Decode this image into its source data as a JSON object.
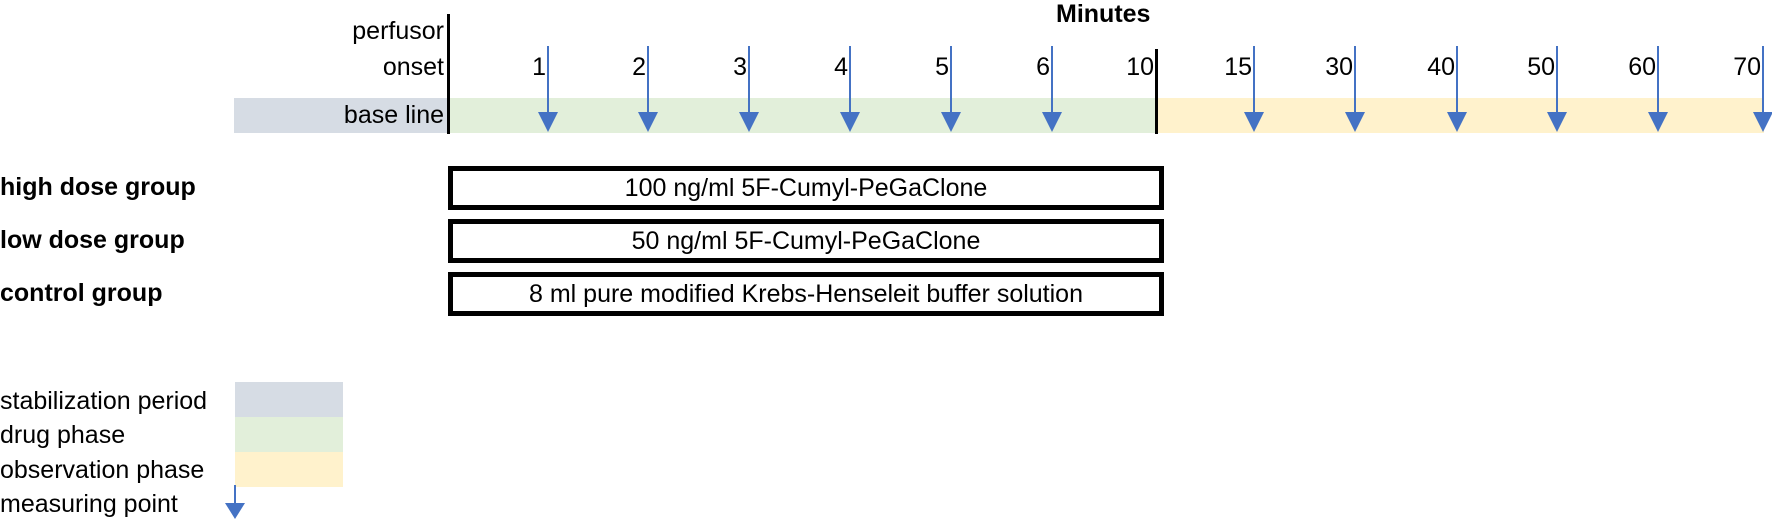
{
  "header": {
    "title": "Minutes",
    "row_label_line1": "perfusor",
    "row_label_line2": "onset",
    "baseline_label": "base line"
  },
  "timeline": {
    "ticks": [
      {
        "label": "1",
        "phase": "drug",
        "measuring_point": true
      },
      {
        "label": "2",
        "phase": "drug",
        "measuring_point": true
      },
      {
        "label": "3",
        "phase": "drug",
        "measuring_point": true
      },
      {
        "label": "4",
        "phase": "drug",
        "measuring_point": true
      },
      {
        "label": "5",
        "phase": "drug",
        "measuring_point": true
      },
      {
        "label": "6",
        "phase": "drug",
        "measuring_point": true
      },
      {
        "label": "10",
        "phase": "drug-end",
        "measuring_point": false
      },
      {
        "label": "15",
        "phase": "observation",
        "measuring_point": true
      },
      {
        "label": "30",
        "phase": "observation",
        "measuring_point": true
      },
      {
        "label": "40",
        "phase": "observation",
        "measuring_point": true
      },
      {
        "label": "50",
        "phase": "observation",
        "measuring_point": true
      },
      {
        "label": "60",
        "phase": "observation",
        "measuring_point": true
      },
      {
        "label": "70",
        "phase": "observation",
        "measuring_point": true
      }
    ]
  },
  "groups": [
    {
      "name": "high dose group",
      "treatment": "100 ng/ml 5F-Cumyl-PeGaClone"
    },
    {
      "name": "low dose group",
      "treatment": "50 ng/ml 5F-Cumyl-PeGaClone"
    },
    {
      "name": "control group",
      "treatment": "8 ml pure modified Krebs-Henseleit buffer solution"
    }
  ],
  "legend": [
    {
      "label": "stabilization period",
      "color": "#d6dce4"
    },
    {
      "label": "drug phase",
      "color": "#e2efda"
    },
    {
      "label": "observation phase",
      "color": "#fff2cc"
    },
    {
      "label": "measuring point",
      "color": "#4472c4"
    }
  ],
  "colors": {
    "stabilization": "#d6dce4",
    "drug": "#e2efda",
    "observation": "#fff2cc",
    "arrow": "#4472c4"
  }
}
